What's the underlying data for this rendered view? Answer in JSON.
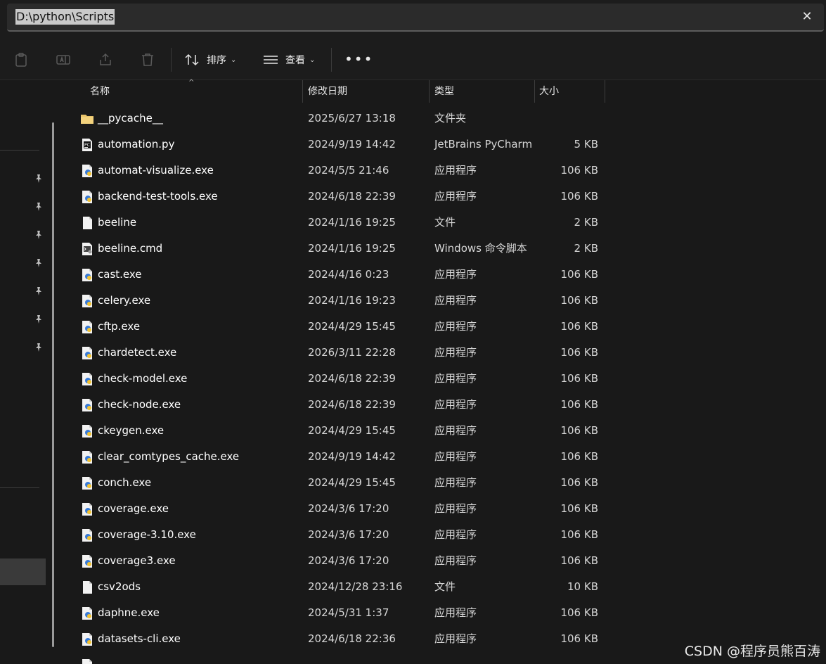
{
  "address_bar": {
    "path": "D:\\python\\Scripts",
    "close": "✕"
  },
  "toolbar": {
    "sort_label": "排序",
    "view_label": "查看",
    "more": "•••"
  },
  "columns": {
    "name": "名称",
    "date": "修改日期",
    "type": "类型",
    "size": "大小"
  },
  "files": [
    {
      "name": "__pycache__",
      "date": "2025/6/27 13:18",
      "type": "文件夹",
      "size": "",
      "icon": "folder-icon"
    },
    {
      "name": "automation.py",
      "date": "2024/9/19 14:42",
      "type": "JetBrains PyCharm",
      "size": "5 KB",
      "icon": "pycharm-file-icon"
    },
    {
      "name": "automat-visualize.exe",
      "date": "2024/5/5 21:46",
      "type": "应用程序",
      "size": "106 KB",
      "icon": "exe-file-icon"
    },
    {
      "name": "backend-test-tools.exe",
      "date": "2024/6/18 22:39",
      "type": "应用程序",
      "size": "106 KB",
      "icon": "exe-file-icon"
    },
    {
      "name": "beeline",
      "date": "2024/1/16 19:25",
      "type": "文件",
      "size": "2 KB",
      "icon": "blank-file-icon"
    },
    {
      "name": "beeline.cmd",
      "date": "2024/1/16 19:25",
      "type": "Windows 命令脚本",
      "size": "2 KB",
      "icon": "cmd-file-icon"
    },
    {
      "name": "cast.exe",
      "date": "2024/4/16 0:23",
      "type": "应用程序",
      "size": "106 KB",
      "icon": "exe-file-icon"
    },
    {
      "name": "celery.exe",
      "date": "2024/1/16 19:23",
      "type": "应用程序",
      "size": "106 KB",
      "icon": "exe-file-icon"
    },
    {
      "name": "cftp.exe",
      "date": "2024/4/29 15:45",
      "type": "应用程序",
      "size": "106 KB",
      "icon": "exe-file-icon"
    },
    {
      "name": "chardetect.exe",
      "date": "2026/3/11 22:28",
      "type": "应用程序",
      "size": "106 KB",
      "icon": "exe-file-icon"
    },
    {
      "name": "check-model.exe",
      "date": "2024/6/18 22:39",
      "type": "应用程序",
      "size": "106 KB",
      "icon": "exe-file-icon"
    },
    {
      "name": "check-node.exe",
      "date": "2024/6/18 22:39",
      "type": "应用程序",
      "size": "106 KB",
      "icon": "exe-file-icon"
    },
    {
      "name": "ckeygen.exe",
      "date": "2024/4/29 15:45",
      "type": "应用程序",
      "size": "106 KB",
      "icon": "exe-file-icon"
    },
    {
      "name": "clear_comtypes_cache.exe",
      "date": "2024/9/19 14:42",
      "type": "应用程序",
      "size": "106 KB",
      "icon": "exe-file-icon"
    },
    {
      "name": "conch.exe",
      "date": "2024/4/29 15:45",
      "type": "应用程序",
      "size": "106 KB",
      "icon": "exe-file-icon"
    },
    {
      "name": "coverage.exe",
      "date": "2024/3/6 17:20",
      "type": "应用程序",
      "size": "106 KB",
      "icon": "exe-file-icon"
    },
    {
      "name": "coverage-3.10.exe",
      "date": "2024/3/6 17:20",
      "type": "应用程序",
      "size": "106 KB",
      "icon": "exe-file-icon"
    },
    {
      "name": "coverage3.exe",
      "date": "2024/3/6 17:20",
      "type": "应用程序",
      "size": "106 KB",
      "icon": "exe-file-icon"
    },
    {
      "name": "csv2ods",
      "date": "2024/12/28 23:16",
      "type": "文件",
      "size": "10 KB",
      "icon": "blank-file-icon"
    },
    {
      "name": "daphne.exe",
      "date": "2024/5/31 1:37",
      "type": "应用程序",
      "size": "106 KB",
      "icon": "exe-file-icon"
    },
    {
      "name": "datasets-cli.exe",
      "date": "2024/6/18 22:36",
      "type": "应用程序",
      "size": "106 KB",
      "icon": "exe-file-icon"
    },
    {
      "name": "",
      "date": "",
      "type": "",
      "size": "",
      "icon": "exe-file-icon"
    }
  ],
  "watermark": "CSDN @程序员熊百涛"
}
